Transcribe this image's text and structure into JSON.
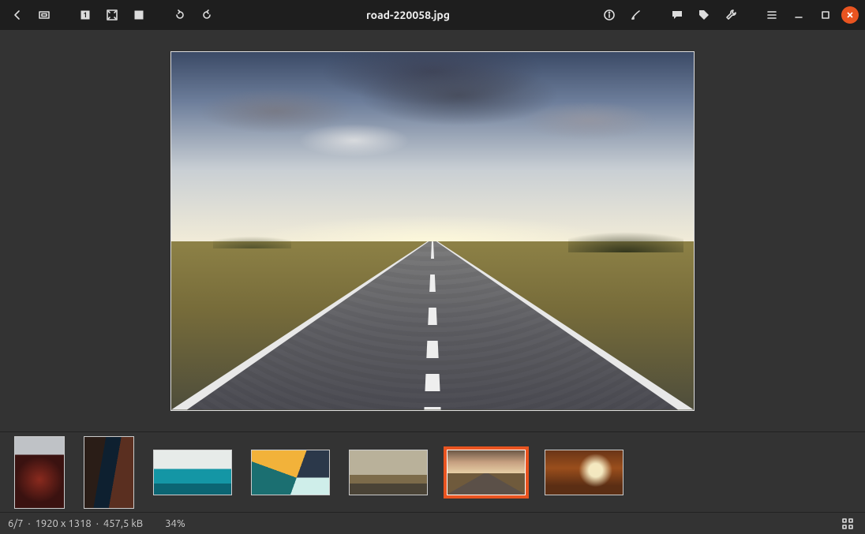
{
  "title": "road-220058.jpg",
  "toolbar": {
    "back": "Back",
    "fullscreen": "Fullscreen",
    "zoom_actual": "Actual size",
    "zoom_fit": "Fit to window",
    "zoom_in": "Zoom in",
    "rotate_left": "Rotate left",
    "rotate_right": "Rotate right",
    "info": "Properties",
    "edit": "Edit",
    "comment": "Comment",
    "tag": "Tags",
    "tools": "Tools",
    "menu": "Menu",
    "minimize": "Minimize",
    "maximize": "Maximize",
    "close": "Close"
  },
  "thumbnails": [
    {
      "name": "tram-portrait",
      "orientation": "portrait",
      "selected": false
    },
    {
      "name": "canyon-portrait",
      "orientation": "portrait",
      "selected": false
    },
    {
      "name": "ocean-wave",
      "orientation": "landscape",
      "selected": false
    },
    {
      "name": "geometric",
      "orientation": "landscape",
      "selected": false
    },
    {
      "name": "desert-hills",
      "orientation": "landscape",
      "selected": false
    },
    {
      "name": "road",
      "orientation": "landscape",
      "selected": true
    },
    {
      "name": "autumn-forest",
      "orientation": "landscape",
      "selected": false
    }
  ],
  "status": {
    "position": "6/7",
    "dimensions": "1920 x 1318",
    "filesize": "457,5 kB",
    "zoom": "34%",
    "separator": "  ·  "
  },
  "colors": {
    "accent": "#e95420",
    "bg": "#333333",
    "header": "#1e1e1e"
  }
}
